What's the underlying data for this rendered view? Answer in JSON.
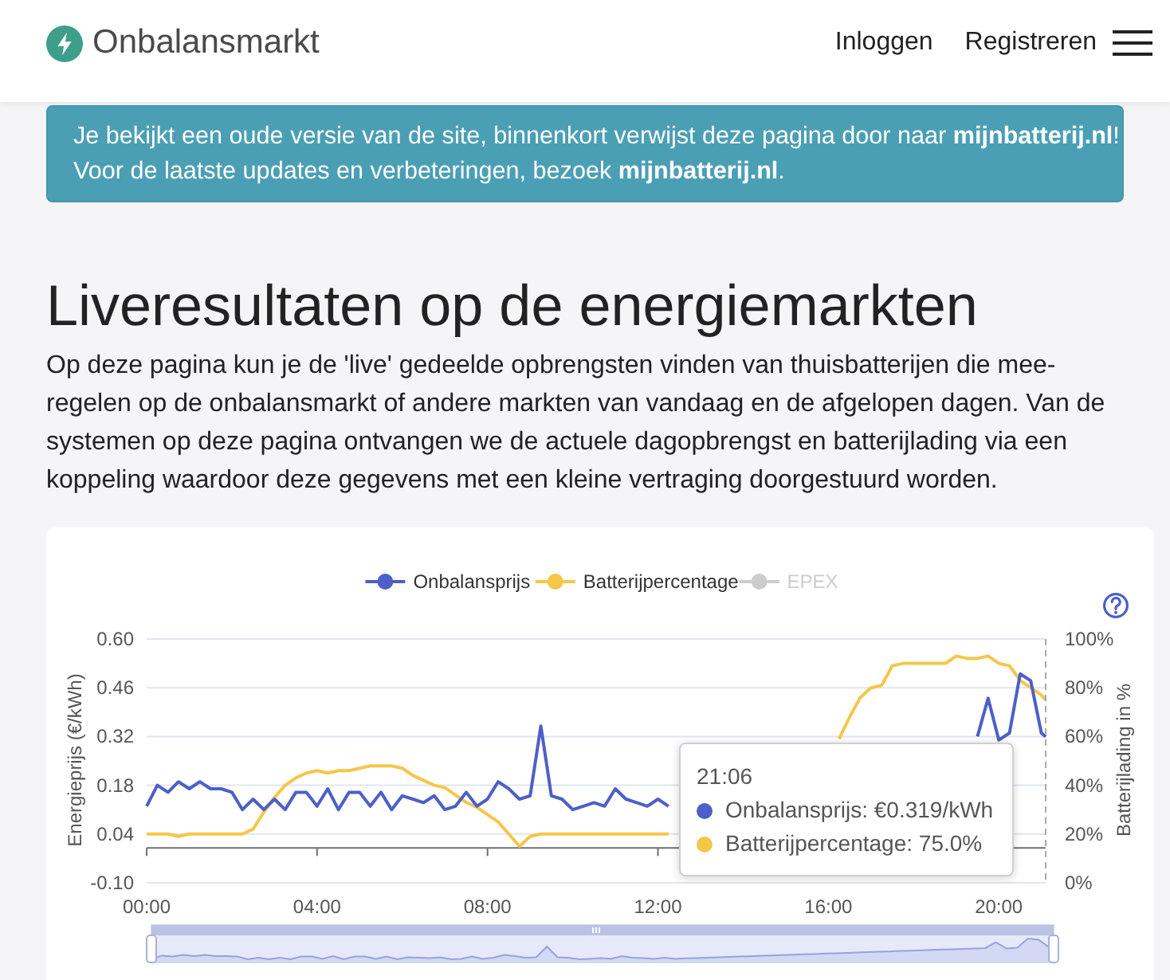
{
  "header": {
    "brand": "Onbalansmarkt",
    "nav": [
      "Inloggen",
      "Registreren"
    ]
  },
  "notice": {
    "lines": [
      "Je bekijkt een oude versie van de site, binnenkort verwijst deze pagina door naar **mijnbatterij.nl**!",
      "Voor de laatste updates en verbeteringen, bezoek **mijnbatterij.nl**."
    ]
  },
  "page": {
    "title": "Liveresultaten op de energiemarkten",
    "intro": "Op deze pagina kun je de 'live' gedeelde opbrengsten vinden van thuisbatterijen die mee-regelen op de onbalansmarkt of andere markten van vandaag en de afgelopen dagen. Van de systemen op deze pagina ontvangen we de actuele dagopbrengst en batterijlading via een koppeling waardoor deze gegevens met een kleine vertraging doorgestuurd worden."
  },
  "chart": {
    "legend_items": [
      {
        "selected": true
      },
      {
        "selected": true
      },
      {
        "label": "EPEX",
        "selected": false
      }
    ],
    "tooltip": {
      "title": "21:06",
      "items": [
        {
          "text": "Onbalansprijs: €0.319/kWh",
          "color": "#4d5fc8"
        },
        {
          "text": "Batterijpercentage: 75.0%",
          "color": "#f5c748"
        }
      ]
    },
    "chart_data": {
      "type": "line",
      "grid": true,
      "legend": "top",
      "ylabel": "Energieprijs (€/kWh)",
      "y2label": "Batterijlading in %",
      "xlim": [
        0,
        21.1
      ],
      "ylim": [
        -0.1,
        0.6
      ],
      "y2lim": [
        0,
        100
      ],
      "xticks": [
        {
          "value": 0,
          "label": "00:00"
        },
        {
          "value": 4,
          "label": "04:00"
        },
        {
          "value": 8,
          "label": "08:00"
        },
        {
          "value": 12,
          "label": "12:00"
        },
        {
          "value": 16,
          "label": "16:00"
        },
        {
          "value": 20,
          "label": "20:00"
        }
      ],
      "yticks": [
        {
          "value": 0.6,
          "label": "0.60"
        },
        {
          "value": 0.46,
          "label": "0.46"
        },
        {
          "value": 0.32,
          "label": "0.32"
        },
        {
          "value": 0.18,
          "label": "0.18"
        },
        {
          "value": 0.04,
          "label": "0.04"
        },
        {
          "value": -0.1,
          "label": "-0.10"
        }
      ],
      "y2ticks": [
        {
          "value": 100,
          "label": "100%"
        },
        {
          "value": 80,
          "label": "80%"
        },
        {
          "value": 60,
          "label": "60%"
        },
        {
          "value": 40,
          "label": "40%"
        },
        {
          "value": 20,
          "label": "20%"
        },
        {
          "value": 0,
          "label": "0%"
        }
      ],
      "x": [
        0,
        0.25,
        0.5,
        0.75,
        1,
        1.25,
        1.5,
        1.75,
        2,
        2.25,
        2.5,
        2.75,
        3,
        3.25,
        3.5,
        3.75,
        4,
        4.25,
        4.5,
        4.75,
        5,
        5.25,
        5.5,
        5.75,
        6,
        6.25,
        6.5,
        6.75,
        7,
        7.25,
        7.5,
        7.75,
        8,
        8.25,
        8.5,
        8.75,
        9,
        9.25,
        9.5,
        9.75,
        10,
        10.25,
        10.5,
        10.75,
        11,
        11.25,
        11.5,
        11.75,
        12,
        12.25,
        12.5,
        12.75,
        13,
        13.25,
        13.5,
        13.75,
        14,
        14.25,
        14.5,
        14.75,
        15,
        15.25,
        15.5,
        15.75,
        16,
        16.25,
        16.5,
        16.75,
        17,
        17.25,
        17.5,
        17.75,
        18,
        18.25,
        18.5,
        18.75,
        19,
        19.25,
        19.5,
        19.75,
        20,
        20.25,
        20.5,
        20.75,
        21,
        21.1
      ],
      "series": [
        {
          "name": "Onbalansprijs",
          "color": "#4d5fc8",
          "values": [
            0.12,
            0.18,
            0.16,
            0.19,
            0.17,
            0.19,
            0.17,
            0.17,
            0.16,
            0.11,
            0.14,
            0.11,
            0.14,
            0.11,
            0.16,
            0.16,
            0.12,
            0.17,
            0.11,
            0.16,
            0.16,
            0.12,
            0.16,
            0.11,
            0.15,
            0.14,
            0.13,
            0.15,
            0.11,
            0.12,
            0.16,
            0.12,
            0.14,
            0.19,
            0.17,
            0.14,
            0.15,
            0.35,
            0.15,
            0.14,
            0.11,
            0.12,
            0.13,
            0.12,
            0.17,
            0.14,
            0.13,
            0.12,
            0.14,
            0.12,
            null,
            null,
            null,
            null,
            null,
            null,
            null,
            null,
            null,
            null,
            null,
            null,
            null,
            null,
            null,
            null,
            null,
            null,
            null,
            null,
            null,
            null,
            null,
            null,
            null,
            null,
            null,
            null,
            0.32,
            0.43,
            0.31,
            0.33,
            0.5,
            0.48,
            0.33,
            0.319
          ]
        },
        {
          "name": "Batterijpercentage",
          "color": "#f5c748",
          "axis": "y2",
          "values": [
            20,
            20,
            20,
            19,
            20,
            20,
            20,
            20,
            20,
            20,
            22,
            29,
            35,
            40,
            43,
            45,
            46,
            45,
            46,
            46,
            47,
            48,
            48,
            48,
            47,
            44,
            42,
            40,
            39,
            36,
            33,
            31,
            28,
            25,
            20,
            15,
            19,
            20,
            20,
            20,
            20,
            20,
            20,
            20,
            20,
            20,
            20,
            20,
            20,
            20,
            null,
            null,
            null,
            null,
            null,
            null,
            null,
            null,
            null,
            null,
            null,
            null,
            null,
            null,
            null,
            59,
            68,
            76,
            80,
            81,
            89,
            90,
            90,
            90,
            90,
            90,
            93,
            92,
            92,
            93,
            90,
            89,
            83,
            80,
            77,
            75
          ]
        }
      ]
    }
  }
}
